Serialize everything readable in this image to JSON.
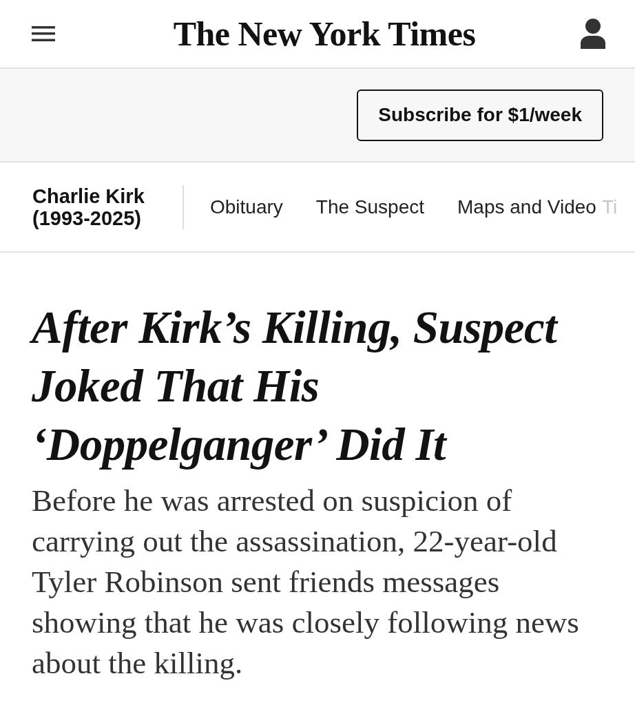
{
  "header": {
    "logo": "The New York Times"
  },
  "promo": {
    "button": "Subscribe for $1/week"
  },
  "section_nav": {
    "title": "Charlie Kirk (1993-2025)",
    "tabs": [
      {
        "label": "Obituary",
        "faded": false
      },
      {
        "label": "The Suspect",
        "faded": false
      },
      {
        "label": "Maps and Video",
        "faded": false
      },
      {
        "label": "Ti",
        "faded": true
      }
    ]
  },
  "article": {
    "headline": "After Kirk’s Killing, Suspect Joked That His ‘Doppelganger’ Did It",
    "summary": "Before he was arrested on suspicion of carrying out the assassination, 22-year-old Tyler Robinson sent friends messages showing that he was closely following news about the killing."
  }
}
